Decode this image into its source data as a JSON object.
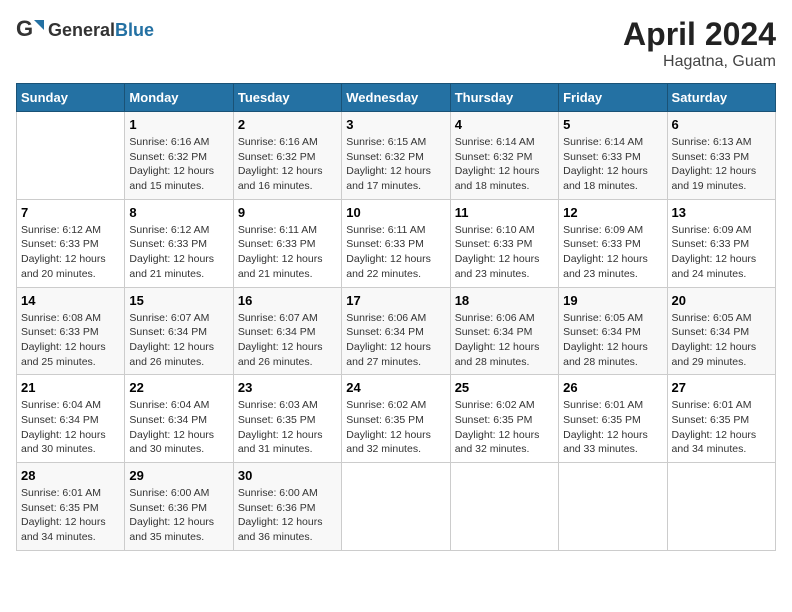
{
  "logo": {
    "text_general": "General",
    "text_blue": "Blue"
  },
  "title": "April 2024",
  "subtitle": "Hagatna, Guam",
  "days_header": [
    "Sunday",
    "Monday",
    "Tuesday",
    "Wednesday",
    "Thursday",
    "Friday",
    "Saturday"
  ],
  "weeks": [
    [
      {
        "num": "",
        "info": ""
      },
      {
        "num": "1",
        "info": "Sunrise: 6:16 AM\nSunset: 6:32 PM\nDaylight: 12 hours\nand 15 minutes."
      },
      {
        "num": "2",
        "info": "Sunrise: 6:16 AM\nSunset: 6:32 PM\nDaylight: 12 hours\nand 16 minutes."
      },
      {
        "num": "3",
        "info": "Sunrise: 6:15 AM\nSunset: 6:32 PM\nDaylight: 12 hours\nand 17 minutes."
      },
      {
        "num": "4",
        "info": "Sunrise: 6:14 AM\nSunset: 6:32 PM\nDaylight: 12 hours\nand 18 minutes."
      },
      {
        "num": "5",
        "info": "Sunrise: 6:14 AM\nSunset: 6:33 PM\nDaylight: 12 hours\nand 18 minutes."
      },
      {
        "num": "6",
        "info": "Sunrise: 6:13 AM\nSunset: 6:33 PM\nDaylight: 12 hours\nand 19 minutes."
      }
    ],
    [
      {
        "num": "7",
        "info": "Sunrise: 6:12 AM\nSunset: 6:33 PM\nDaylight: 12 hours\nand 20 minutes."
      },
      {
        "num": "8",
        "info": "Sunrise: 6:12 AM\nSunset: 6:33 PM\nDaylight: 12 hours\nand 21 minutes."
      },
      {
        "num": "9",
        "info": "Sunrise: 6:11 AM\nSunset: 6:33 PM\nDaylight: 12 hours\nand 21 minutes."
      },
      {
        "num": "10",
        "info": "Sunrise: 6:11 AM\nSunset: 6:33 PM\nDaylight: 12 hours\nand 22 minutes."
      },
      {
        "num": "11",
        "info": "Sunrise: 6:10 AM\nSunset: 6:33 PM\nDaylight: 12 hours\nand 23 minutes."
      },
      {
        "num": "12",
        "info": "Sunrise: 6:09 AM\nSunset: 6:33 PM\nDaylight: 12 hours\nand 23 minutes."
      },
      {
        "num": "13",
        "info": "Sunrise: 6:09 AM\nSunset: 6:33 PM\nDaylight: 12 hours\nand 24 minutes."
      }
    ],
    [
      {
        "num": "14",
        "info": "Sunrise: 6:08 AM\nSunset: 6:33 PM\nDaylight: 12 hours\nand 25 minutes."
      },
      {
        "num": "15",
        "info": "Sunrise: 6:07 AM\nSunset: 6:34 PM\nDaylight: 12 hours\nand 26 minutes."
      },
      {
        "num": "16",
        "info": "Sunrise: 6:07 AM\nSunset: 6:34 PM\nDaylight: 12 hours\nand 26 minutes."
      },
      {
        "num": "17",
        "info": "Sunrise: 6:06 AM\nSunset: 6:34 PM\nDaylight: 12 hours\nand 27 minutes."
      },
      {
        "num": "18",
        "info": "Sunrise: 6:06 AM\nSunset: 6:34 PM\nDaylight: 12 hours\nand 28 minutes."
      },
      {
        "num": "19",
        "info": "Sunrise: 6:05 AM\nSunset: 6:34 PM\nDaylight: 12 hours\nand 28 minutes."
      },
      {
        "num": "20",
        "info": "Sunrise: 6:05 AM\nSunset: 6:34 PM\nDaylight: 12 hours\nand 29 minutes."
      }
    ],
    [
      {
        "num": "21",
        "info": "Sunrise: 6:04 AM\nSunset: 6:34 PM\nDaylight: 12 hours\nand 30 minutes."
      },
      {
        "num": "22",
        "info": "Sunrise: 6:04 AM\nSunset: 6:34 PM\nDaylight: 12 hours\nand 30 minutes."
      },
      {
        "num": "23",
        "info": "Sunrise: 6:03 AM\nSunset: 6:35 PM\nDaylight: 12 hours\nand 31 minutes."
      },
      {
        "num": "24",
        "info": "Sunrise: 6:02 AM\nSunset: 6:35 PM\nDaylight: 12 hours\nand 32 minutes."
      },
      {
        "num": "25",
        "info": "Sunrise: 6:02 AM\nSunset: 6:35 PM\nDaylight: 12 hours\nand 32 minutes."
      },
      {
        "num": "26",
        "info": "Sunrise: 6:01 AM\nSunset: 6:35 PM\nDaylight: 12 hours\nand 33 minutes."
      },
      {
        "num": "27",
        "info": "Sunrise: 6:01 AM\nSunset: 6:35 PM\nDaylight: 12 hours\nand 34 minutes."
      }
    ],
    [
      {
        "num": "28",
        "info": "Sunrise: 6:01 AM\nSunset: 6:35 PM\nDaylight: 12 hours\nand 34 minutes."
      },
      {
        "num": "29",
        "info": "Sunrise: 6:00 AM\nSunset: 6:36 PM\nDaylight: 12 hours\nand 35 minutes."
      },
      {
        "num": "30",
        "info": "Sunrise: 6:00 AM\nSunset: 6:36 PM\nDaylight: 12 hours\nand 36 minutes."
      },
      {
        "num": "",
        "info": ""
      },
      {
        "num": "",
        "info": ""
      },
      {
        "num": "",
        "info": ""
      },
      {
        "num": "",
        "info": ""
      }
    ]
  ]
}
